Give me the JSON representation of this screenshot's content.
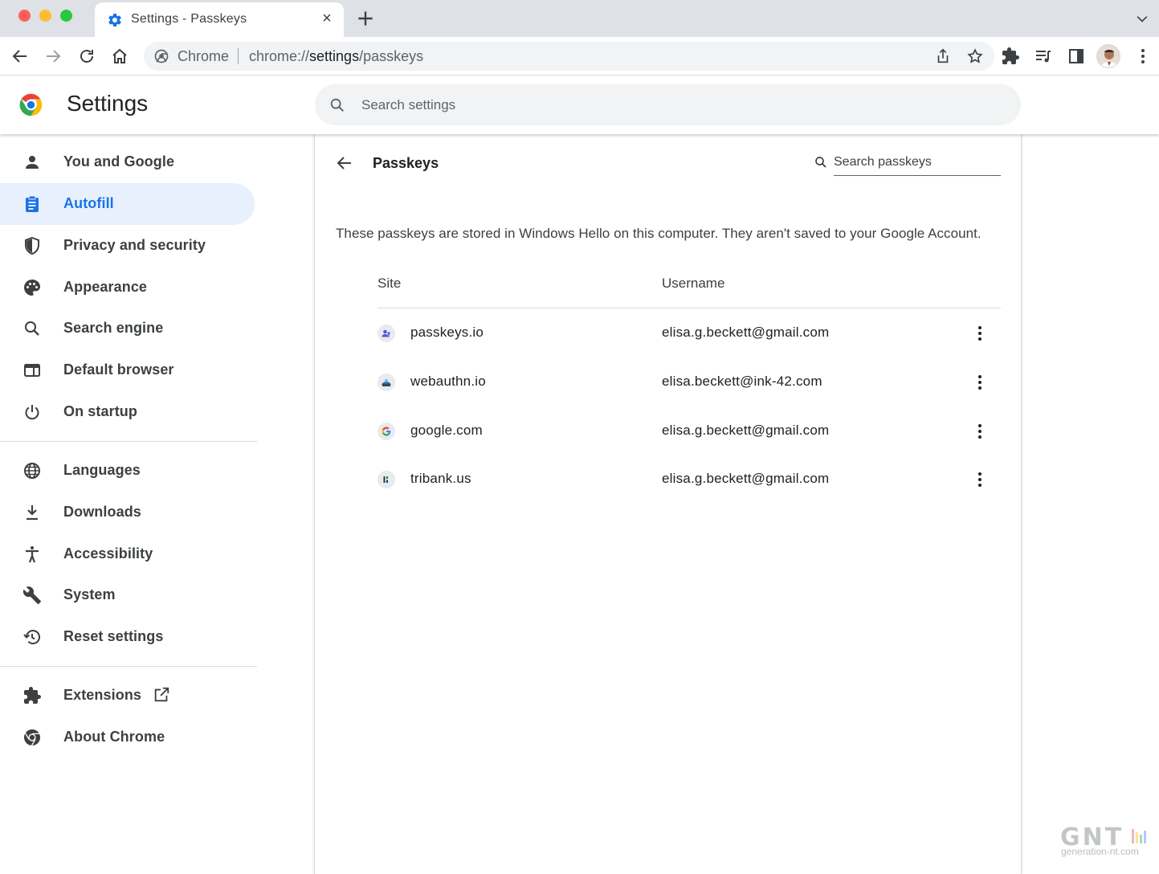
{
  "browser": {
    "tab_title": "Settings - Passkeys",
    "tab_close": "×",
    "omnibox_chrome_label": "Chrome",
    "url_prefix": "chrome://",
    "url_bold": "settings",
    "url_suffix": "/passkeys"
  },
  "header": {
    "title": "Settings",
    "search_placeholder": "Search settings"
  },
  "sidebar": {
    "items": [
      {
        "label": "You and Google",
        "icon": "person-icon"
      },
      {
        "label": "Autofill",
        "icon": "clipboard-icon",
        "active": true
      },
      {
        "label": "Privacy and security",
        "icon": "shield-icon"
      },
      {
        "label": "Appearance",
        "icon": "palette-icon"
      },
      {
        "label": "Search engine",
        "icon": "search-icon"
      },
      {
        "label": "Default browser",
        "icon": "browser-window-icon"
      },
      {
        "label": "On startup",
        "icon": "power-icon"
      },
      {
        "label": "Languages",
        "icon": "globe-icon"
      },
      {
        "label": "Downloads",
        "icon": "download-icon"
      },
      {
        "label": "Accessibility",
        "icon": "accessibility-icon"
      },
      {
        "label": "System",
        "icon": "wrench-icon"
      },
      {
        "label": "Reset settings",
        "icon": "history-icon"
      },
      {
        "label": "Extensions",
        "icon": "puzzle-icon"
      },
      {
        "label": "About Chrome",
        "icon": "chrome-icon"
      }
    ]
  },
  "main": {
    "title": "Passkeys",
    "search_placeholder": "Search passkeys",
    "description": "These passkeys are stored in Windows Hello on this computer. They aren't saved to your Google Account.",
    "columns": {
      "site": "Site",
      "username": "Username"
    },
    "rows": [
      {
        "site": "passkeys.io",
        "username": "elisa.g.beckett@gmail.com"
      },
      {
        "site": "webauthn.io",
        "username": "elisa.beckett@ink-42.com"
      },
      {
        "site": "google.com",
        "username": "elisa.g.beckett@gmail.com"
      },
      {
        "site": "tribank.us",
        "username": "elisa.g.beckett@gmail.com"
      }
    ]
  },
  "watermark": {
    "logo": "GNT",
    "text": "generation-nt.com"
  },
  "colors": {
    "accent": "#1a73e8",
    "active_bg": "#e8f0fe",
    "tabstrip": "#dee1e6",
    "omnibox": "#f1f3f4"
  }
}
